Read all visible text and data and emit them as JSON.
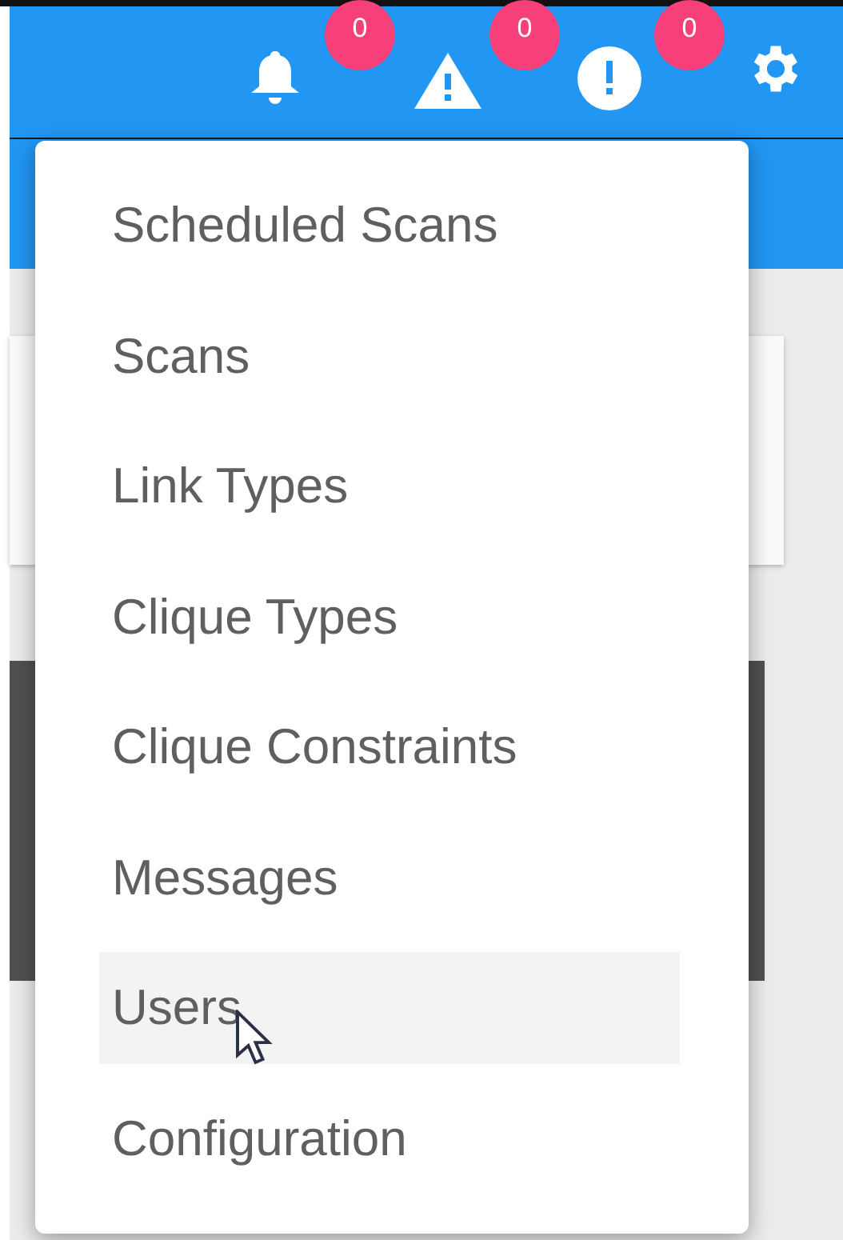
{
  "toolbar": {
    "indicators": [
      {
        "kind": "bell",
        "count": "0"
      },
      {
        "kind": "warning",
        "count": "0"
      },
      {
        "kind": "error",
        "count": "0"
      }
    ]
  },
  "menu": {
    "items": [
      {
        "label": "Scheduled Scans",
        "hovered": false
      },
      {
        "label": "Scans",
        "hovered": false
      },
      {
        "label": "Link Types",
        "hovered": false
      },
      {
        "label": "Clique Types",
        "hovered": false
      },
      {
        "label": "Clique Constraints",
        "hovered": false
      },
      {
        "label": "Messages",
        "hovered": false
      },
      {
        "label": "Users",
        "hovered": true
      },
      {
        "label": "Configuration",
        "hovered": false
      }
    ]
  }
}
